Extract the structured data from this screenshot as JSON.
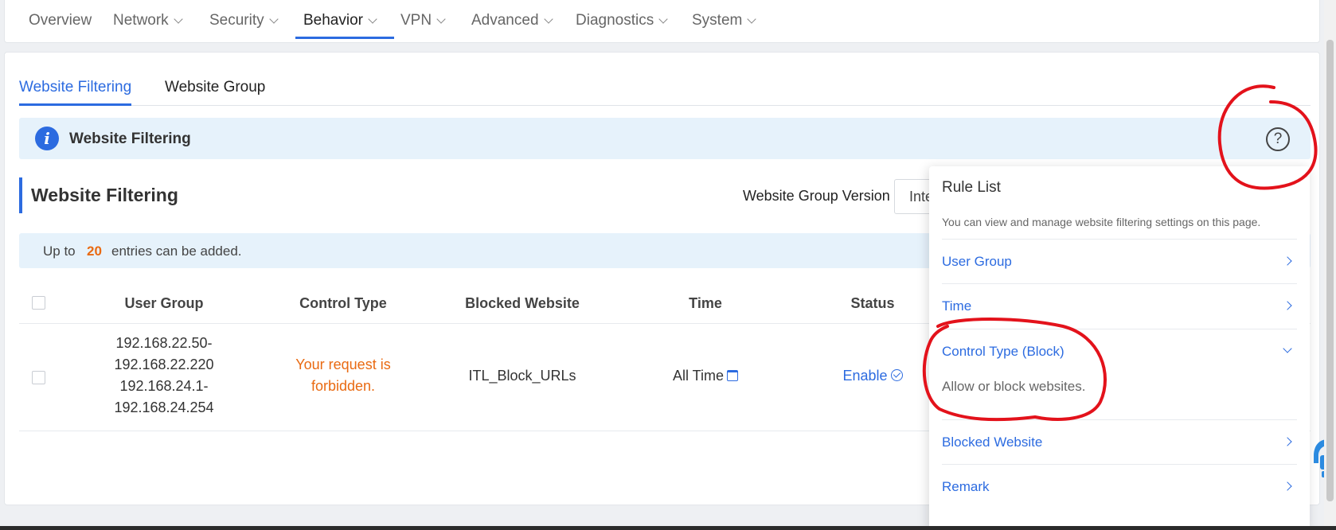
{
  "nav": {
    "items": [
      {
        "label": "Overview"
      },
      {
        "label": "Network"
      },
      {
        "label": "Security"
      },
      {
        "label": "Behavior"
      },
      {
        "label": "VPN"
      },
      {
        "label": "Advanced"
      },
      {
        "label": "Diagnostics"
      },
      {
        "label": "System"
      }
    ],
    "active": "Behavior"
  },
  "tabs": [
    {
      "label": "Website Filtering"
    },
    {
      "label": "Website Group"
    }
  ],
  "banner": {
    "title": "Website Filtering",
    "icon": "info-icon",
    "help_icon": "question-circle-icon"
  },
  "section": {
    "title": "Website Filtering",
    "version_label": "Website Group Version",
    "version_value": "Inte"
  },
  "limit": {
    "prefix": "Up to",
    "count": "20",
    "suffix": "entries can be added."
  },
  "table": {
    "headers": [
      "User Group",
      "Control Type",
      "Blocked Website",
      "Time",
      "Status"
    ],
    "rows": [
      {
        "user_group": [
          "192.168.22.50-",
          "192.168.22.220",
          "192.168.24.1-",
          "192.168.24.254"
        ],
        "control_type": [
          "Your request is",
          "forbidden."
        ],
        "blocked_website": "ITL_Block_URLs",
        "time": "All Time",
        "status": "Enable"
      }
    ]
  },
  "help": {
    "title": "Rule List",
    "description": "You can view and manage website filtering settings on this page.",
    "items": [
      {
        "label": "User Group"
      },
      {
        "label": "Time"
      },
      {
        "label": "Control Type (Block)",
        "expanded": true,
        "detail": "Allow or block websites."
      },
      {
        "label": "Blocked Website"
      },
      {
        "label": "Remark"
      }
    ]
  },
  "colors": {
    "accent": "#2c6be0",
    "warning": "#e96a12",
    "annotation": "#e3121b"
  }
}
